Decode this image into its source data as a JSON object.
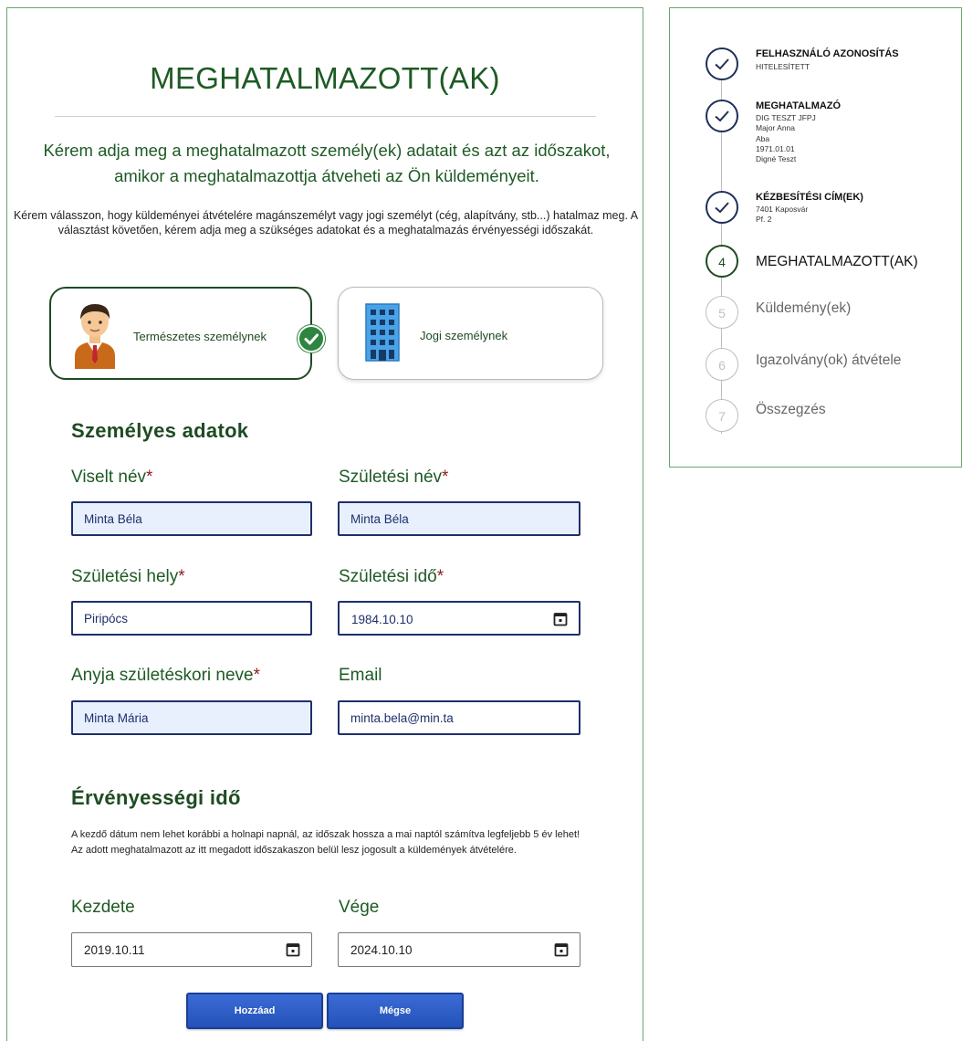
{
  "main": {
    "title": "MEGHATALMAZOTT(AK)",
    "intro": "Kérem adja meg a meghatalmazott személy(ek) adatait és azt az időszakot, amikor a meghatalmazottja átveheti az Ön küldeményeit.",
    "instruction": "Kérem válasszon, hogy küldeményei átvételére magánszemélyt vagy jogi személyt (cég, alapítvány, stb...) hatalmaz meg. A választást követően, kérem adja meg a szükséges adatokat és a meghatalmazás érvényességi időszakát.",
    "choices": {
      "natural": {
        "label": "Természetes személynek",
        "selected": true
      },
      "legal": {
        "label": "Jogi személynek",
        "selected": false
      }
    },
    "personal": {
      "heading": "Személyes adatok",
      "required_mark": "*",
      "fields": {
        "viselt_nev": {
          "label": "Viselt név",
          "value": "Minta Béla"
        },
        "szuletesi_nev": {
          "label": "Születési név",
          "value": "Minta Béla"
        },
        "szuletesi_hely": {
          "label": "Születési hely",
          "value": "Piripócs"
        },
        "szuletesi_ido": {
          "label": "Születési idő",
          "value": "1984.10.10"
        },
        "anyja_neve": {
          "label": "Anyja születéskori neve",
          "value": "Minta Mária"
        },
        "email": {
          "label": "Email",
          "value": "minta.bela@min.ta"
        }
      }
    },
    "validity": {
      "heading": "Érvényességi idő",
      "note": "A kezdő dátum nem lehet korábbi a holnapi napnál, az időszak hossza a mai naptól számítva legfeljebb 5 év lehet! Az adott meghatalmazott az itt megadott időszakaszon belül lesz jogosult a küldemények átvételére.",
      "start": {
        "label": "Kezdete",
        "value": "2019.10.11"
      },
      "end": {
        "label": "Vége",
        "value": "2024.10.10"
      }
    },
    "buttons": {
      "add": "Hozzáad",
      "cancel": "Mégse"
    }
  },
  "steps": [
    {
      "number": "1",
      "title": "FELHASZNÁLÓ AZONOSÍTÁS",
      "details": [
        "HITELESÍTETT"
      ],
      "state": "done"
    },
    {
      "number": "2",
      "title": "MEGHATALMAZÓ",
      "details": [
        "DIG TESZT JFPJ",
        "Major Anna",
        "Aba",
        "1971.01.01",
        "Digné Teszt"
      ],
      "state": "done"
    },
    {
      "number": "3",
      "title": "KÉZBESÍTÉSI CÍM(EK)",
      "details": [
        "7401 Kaposvár",
        "Pf. 2"
      ],
      "state": "done"
    },
    {
      "number": "4",
      "title": "MEGHATALMAZOTT(AK)",
      "details": [],
      "state": "active"
    },
    {
      "number": "5",
      "title": "Küldemény(ek)",
      "details": [],
      "state": "todo"
    },
    {
      "number": "6",
      "title": "Igazolvány(ok) átvétele",
      "details": [],
      "state": "todo"
    },
    {
      "number": "7",
      "title": "Összegzés",
      "details": [],
      "state": "todo"
    }
  ],
  "colors": {
    "heading_green": "#1e5b24",
    "dark_green": "#1e4b22",
    "panel_border": "#6aa66a",
    "input_border": "#1f2f6b",
    "autofill_bg": "#e8f0fe",
    "button_blue": "#2d5cc4",
    "check_green": "#2e8540",
    "required_red": "#8b1d1d"
  }
}
